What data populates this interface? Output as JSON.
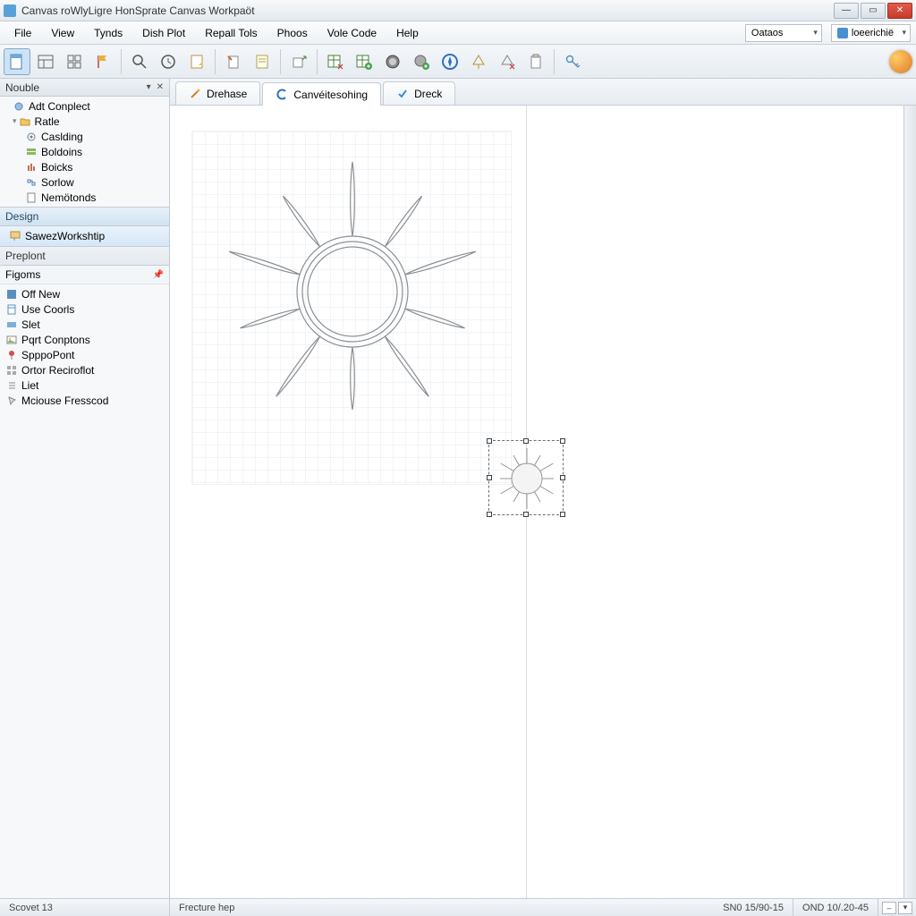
{
  "title": "Canvas roWlyLigre HonSprate Canvas Workpaöt",
  "menu": [
    "File",
    "View",
    "Tynds",
    "Dish Plot",
    "Repall Tols",
    "Phoos",
    "Vole Code",
    "Help"
  ],
  "menu_dropdowns": {
    "left": "Oataos",
    "right": "loeerichië"
  },
  "toolbar_icons": [
    "doc-new",
    "layout",
    "grid",
    "flag",
    "search",
    "clock",
    "sheet",
    "pencil-doc",
    "note",
    "export",
    "table-x",
    "table-add",
    "lens",
    "globe-add",
    "compass",
    "marker",
    "compass-x",
    "clipboard",
    "key"
  ],
  "panel_noble": {
    "title": "Nouble",
    "items": [
      {
        "label": "Adt Conplect",
        "icon": "node"
      },
      {
        "label": "Ratle",
        "icon": "folder"
      },
      {
        "label": "Caslding",
        "icon": "gear"
      },
      {
        "label": "Boldoins",
        "icon": "stack"
      },
      {
        "label": "Boicks",
        "icon": "bars"
      },
      {
        "label": "Sorlow",
        "icon": "flow"
      },
      {
        "label": "Nemötonds",
        "icon": "doc"
      }
    ]
  },
  "panel_design": {
    "title": "Design",
    "items": [
      {
        "label": "SawezWorkshtip",
        "icon": "paint"
      }
    ]
  },
  "panel_preplont": {
    "title": "Preplont"
  },
  "panel_figoms": {
    "title": "Figoms",
    "items": [
      {
        "label": "Off New",
        "icon": "square"
      },
      {
        "label": "Use Coorls",
        "icon": "sheet"
      },
      {
        "label": "Slet",
        "icon": "rect"
      },
      {
        "label": "Pqrt Conptons",
        "icon": "img"
      },
      {
        "label": "SpppoPont",
        "icon": "pin"
      },
      {
        "label": "Ortor Reciroflot",
        "icon": "grid2"
      },
      {
        "label": "Liet",
        "icon": "list"
      },
      {
        "label": "Mciouse Fresscod",
        "icon": "cursor"
      }
    ]
  },
  "tabs": [
    {
      "label": "Drehase",
      "icon": "wand",
      "active": false
    },
    {
      "label": "Canvéitesohing",
      "icon": "c-ring",
      "active": true
    },
    {
      "label": "Dreck",
      "icon": "check",
      "active": false
    }
  ],
  "status": {
    "left": "Scovet 13",
    "hint": "Frecture hep",
    "coord1": "SN0 15/90-15",
    "coord2": "OND 10/.20-45"
  }
}
